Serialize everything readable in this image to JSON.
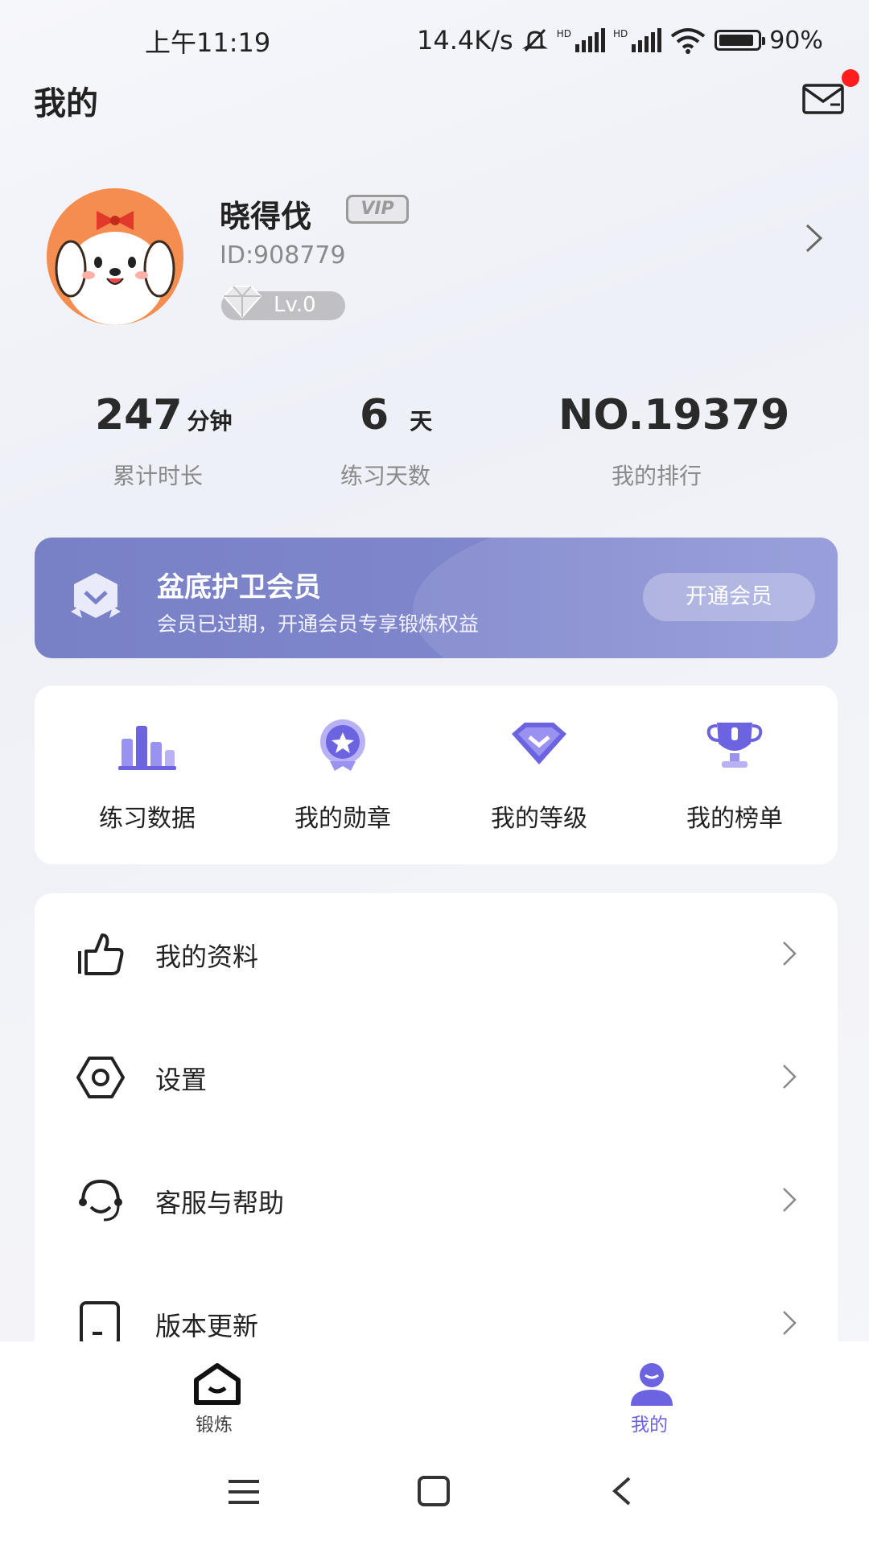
{
  "status_bar": {
    "time": "上午11:19",
    "net_speed": "14.4K/s",
    "sim_label": "HD",
    "battery": "90%"
  },
  "header": {
    "title": "我的"
  },
  "profile": {
    "username": "晓得伐",
    "vip_label": "VIP",
    "user_id": "ID:908779",
    "level": "Lv.0"
  },
  "stats": [
    {
      "value": "247",
      "unit": "分钟",
      "label": "累计时长"
    },
    {
      "value": "6",
      "unit": "天",
      "label": "练习天数"
    },
    {
      "value": "NO.19379",
      "unit": "",
      "label": "我的排行"
    }
  ],
  "member": {
    "title": "盆底护卫会员",
    "subtitle": "会员已过期，开通会员专享锻炼权益",
    "button": "开通会员"
  },
  "quick_actions": [
    {
      "label": "练习数据",
      "icon": "bar-chart-icon"
    },
    {
      "label": "我的勋章",
      "icon": "medal-icon"
    },
    {
      "label": "我的等级",
      "icon": "level-diamond-icon"
    },
    {
      "label": "我的榜单",
      "icon": "trophy-icon"
    }
  ],
  "menu": [
    {
      "label": "我的资料",
      "icon": "thumbs-up-icon"
    },
    {
      "label": "设置",
      "icon": "settings-hex-icon"
    },
    {
      "label": "客服与帮助",
      "icon": "headset-icon"
    },
    {
      "label": "版本更新",
      "icon": "update-icon"
    }
  ],
  "bottom_nav": [
    {
      "label": "锻炼",
      "icon": "exercise-icon",
      "active": false
    },
    {
      "label": "我的",
      "icon": "profile-icon",
      "active": true
    }
  ],
  "colors": {
    "accent": "#6b63e0",
    "banner": "#7880c6",
    "notify_dot": "#ff1d1d"
  }
}
